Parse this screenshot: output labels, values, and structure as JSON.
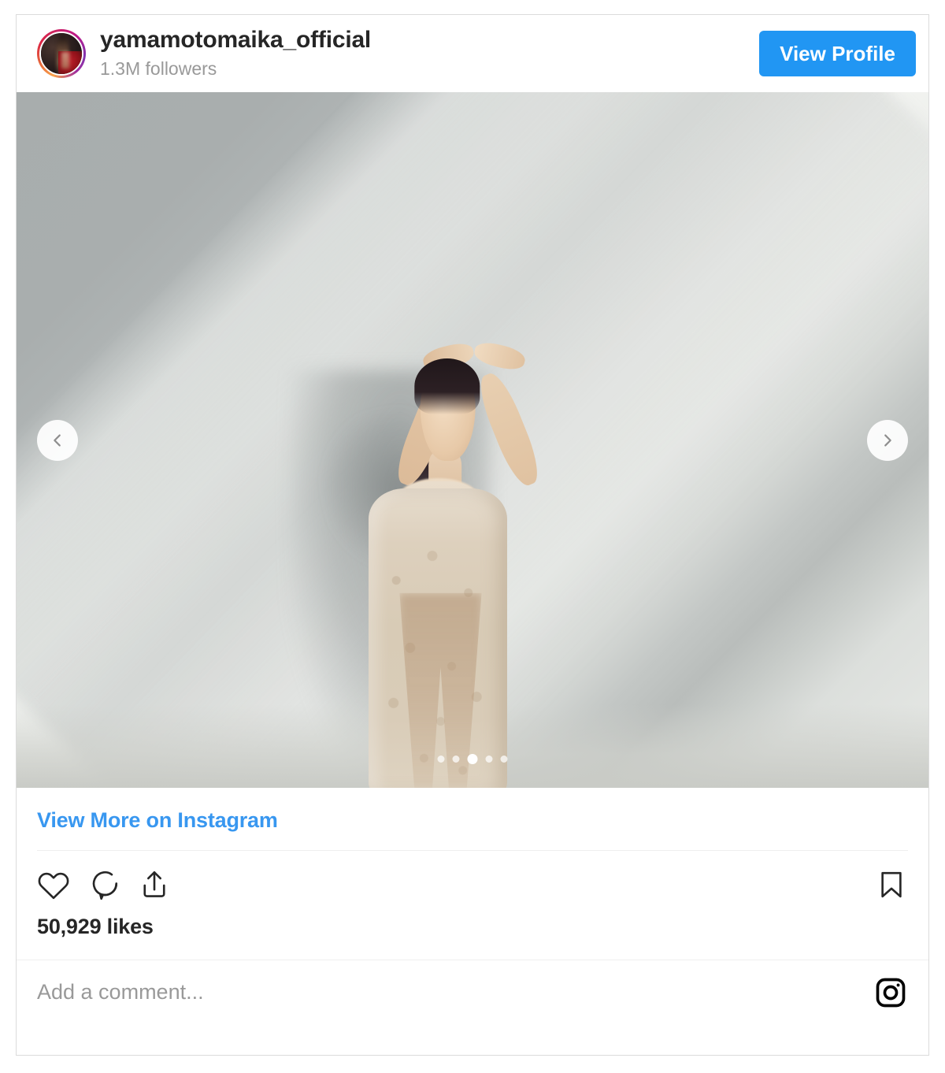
{
  "header": {
    "avatar": "profile-avatar",
    "username": "yamamotomaika_official",
    "followers": "1.3M followers",
    "view_profile_label": "View Profile",
    "accent_color": "#2196f3"
  },
  "media": {
    "alt": "Woman in sheer cream lace dress posing against a sunlit white wall with diagonal shadows",
    "prev_icon": "chevron-left-icon",
    "next_icon": "chevron-right-icon",
    "carousel": {
      "total": 5,
      "active_index": 2
    }
  },
  "footer": {
    "view_more_label": "View More on Instagram",
    "view_more_color": "#3897f0",
    "actions": {
      "like_icon": "heart-icon",
      "comment_icon": "comment-bubble-icon",
      "share_icon": "share-icon",
      "save_icon": "bookmark-icon"
    },
    "likes": "50,929 likes",
    "comment_placeholder": "Add a comment...",
    "instagram_icon": "instagram-logo-icon"
  }
}
